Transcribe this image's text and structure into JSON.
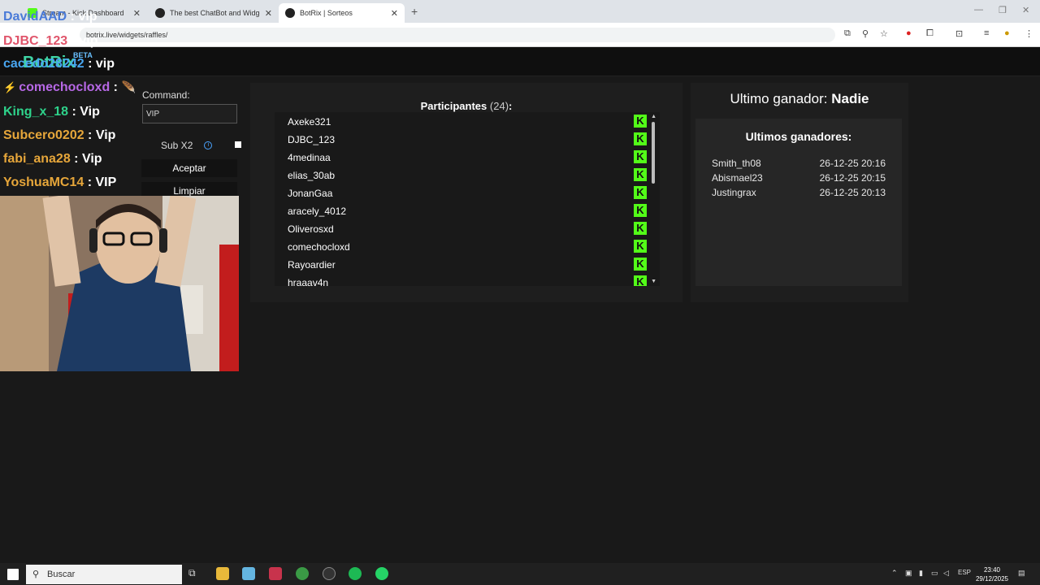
{
  "browser": {
    "tabs": [
      {
        "label": "Stream - Kick Dashboard",
        "active": false
      },
      {
        "label": "The best ChatBot and Widgets",
        "active": false
      },
      {
        "label": "BotRix | Sorteos",
        "active": true
      }
    ],
    "url": "botrix.live/widgets/raffles/"
  },
  "site": {
    "brand": "BotRix",
    "beta": "BETA"
  },
  "controls": {
    "command_label": "Command:",
    "command_value": "VIP",
    "sub_label": "Sub X2",
    "accept_label": "Aceptar",
    "clear_label": "Limpiar"
  },
  "participants": {
    "title": "Participantes",
    "count": "(24)",
    "colon": ":",
    "names": [
      "Axeke321",
      "DJBC_123",
      "4medinaa",
      "elias_30ab",
      "JonanGaa",
      "aracely_4012",
      "Oliverosxd",
      "comechocloxd",
      "Rayoardier",
      "hraaav4n"
    ]
  },
  "winner": {
    "title_prefix": "Ultimo ganador:",
    "name": "Nadie",
    "recent_title": "Ultimos ganadores:",
    "recent": [
      {
        "name": "Smith_th08",
        "date": "26-12-25 20:16"
      },
      {
        "name": "Abismael23",
        "date": "26-12-25 20:15"
      },
      {
        "name": "Justingrax",
        "date": "26-12-25 20:13"
      }
    ]
  },
  "stream_chat": [
    {
      "user": "DavidAAD",
      "msg": "vip",
      "color": "#4a7bd8"
    },
    {
      "user": "DJBC_123",
      "msg": "vip",
      "color": "#e0556b"
    },
    {
      "user": "cacedo28242",
      "msg": "vip",
      "color": "#49a6f0"
    },
    {
      "user": "comechocloxd",
      "msg": "",
      "color": "#b768e6"
    },
    {
      "user": "King_x_18",
      "msg": "Vip",
      "color": "#2ed38b"
    },
    {
      "user": "Subcero0202",
      "msg": "Vip",
      "color": "#e6a63a"
    },
    {
      "user": "fabi_ana28",
      "msg": "Vip",
      "color": "#e6a63a"
    },
    {
      "user": "YoshuaMC14",
      "msg": "VIP",
      "color": "#e6a63a"
    }
  ],
  "taskbar": {
    "search": "Buscar",
    "time": "23:40",
    "date": "29/12/2025",
    "lang": "ESP"
  }
}
